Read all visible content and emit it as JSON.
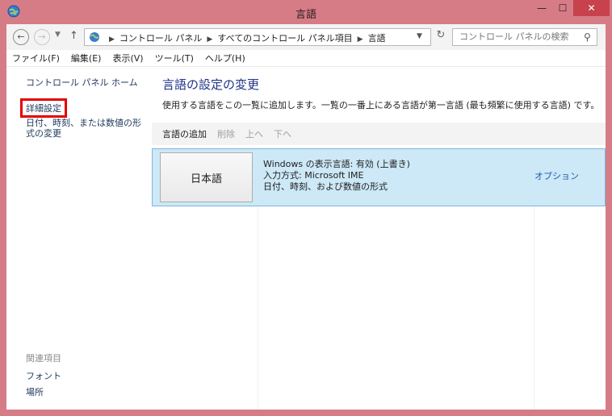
{
  "window": {
    "title": "言語"
  },
  "title_buttons": {
    "minimize": "—",
    "maximize": "☐",
    "close": "✕"
  },
  "address": {
    "crumbs": [
      "コントロール パネル",
      "すべてのコントロール パネル項目",
      "言語"
    ]
  },
  "search": {
    "placeholder": "コントロール パネルの検索"
  },
  "menu": [
    "ファイル(F)",
    "編集(E)",
    "表示(V)",
    "ツール(T)",
    "ヘルプ(H)"
  ],
  "sidebar": {
    "home": "コントロール パネル ホーム",
    "advanced": "詳細設定",
    "date_format": "日付、時刻、または数値の形式の変更",
    "related_heading": "関連項目",
    "fonts": "フォント",
    "location": "場所"
  },
  "main": {
    "title": "言語の設定の変更",
    "description": "使用する言語をこの一覧に追加します。一覧の一番上にある言語が第一言語 (最も頻繁に使用する言語) です。",
    "toolbar": {
      "add": "言語の追加",
      "remove": "削除",
      "up": "上へ",
      "down": "下へ"
    },
    "languages": [
      {
        "name": "日本語",
        "info1": "Windows の表示言語: 有効 (上書き)",
        "info2": "入力方式: Microsoft IME",
        "info3": "日付、時刻、および数値の形式",
        "options": "オプション"
      }
    ]
  },
  "colors": {
    "frame": "#d67c87",
    "highlight": "#cde8f6",
    "link": "#1e395b",
    "title": "#1e3287",
    "red_box": "#e50000"
  }
}
